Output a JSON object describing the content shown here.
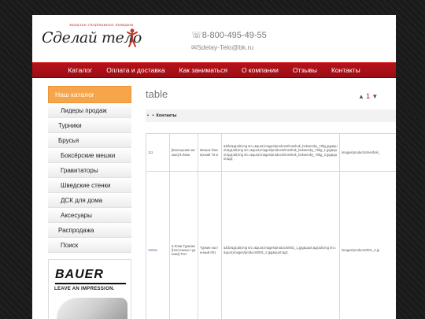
{
  "header": {
    "logo_tagline": "магазин спортивных товаров",
    "logo_text": "Сделай тело",
    "phone": "8-800-495-49-55",
    "email": "Sdelay-Telo@bk.ru",
    "phone_icon": "phone-icon",
    "mail_icon": "mail-icon"
  },
  "nav": {
    "items": [
      "Каталог",
      "Оплата и доставка",
      "Как заниматься",
      "О компании",
      "Отзывы",
      "Контакты"
    ]
  },
  "sidebar": {
    "header": "Наш каталог",
    "items": [
      "Лидеры продаж",
      "Турники",
      "Брусья",
      "Боксёрские мешки",
      "Гравитаторы",
      "Шведские стенки",
      "ДСК для дома",
      "Аксесуары",
      "Распродажа",
      "Поиск"
    ]
  },
  "ad": {
    "brand": "BAUER",
    "tagline": "LEAVE AN IMPRESSION."
  },
  "main": {
    "title": "table",
    "pager": {
      "prev": "▲",
      "page": "1",
      "next": "▼"
    },
    "breadcrumb": {
      "b1": "•",
      "b2": "•",
      "label": "Контакты"
    },
    "rows": [
      {
        "id": "111",
        "name": "[Боксерские мешки] 8.Лови",
        "desc": "Мешок боксёрский 70 кг",
        "html": "&lt;br&gt;&lt;img src=&quot;images/products/meshok_boksersky_70kg.jpg&quot;&gt;&lt;img src=&quot;images/products/meshok_boksersky_70kg_1.jpg&quot;&gt;&lt;img src=&quot;images/products/meshok_boksersky_70kg_2.jpg&quot;&gt;",
        "img": "images/products/meshok_"
      },
      {
        "id": "10016",
        "name": "8.Лови Турники [Настенные турники] Тест",
        "desc": "Турник настенный 001",
        "html": "&lt;br&gt;&lt;img src=&quot;images/products/001_1.jpg&quot;&gt;&lt;img src=&quot;images/products/001_2.jpg&quot;&gt;",
        "img": "images/products/001_2.jp"
      }
    ]
  },
  "colors": {
    "nav_red": "#b5121b",
    "catalog_orange": "#f6a54a",
    "page_bg": "#1a1a1a"
  }
}
